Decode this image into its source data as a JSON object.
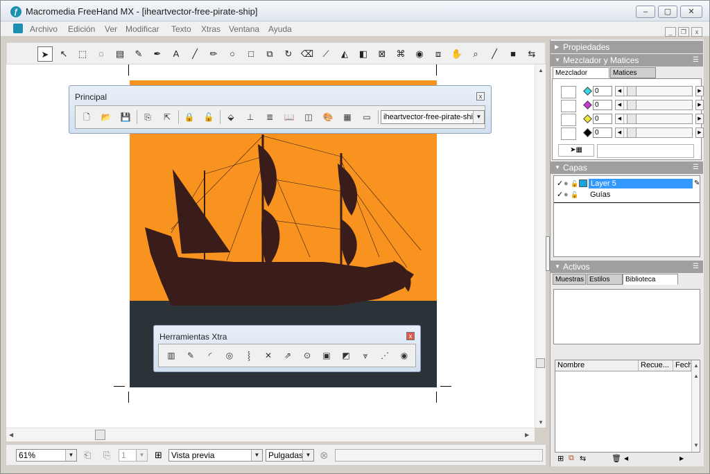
{
  "window": {
    "title": "Macromedia FreeHand MX - [iheartvector-free-pirate-ship]",
    "controls": {
      "minimize": "–",
      "maximize": "▢",
      "close": "✕"
    }
  },
  "menubar": {
    "items": [
      "Archivo",
      "Edición",
      "Ver",
      "Modificar",
      "Texto",
      "Xtras",
      "Ventana",
      "Ayuda"
    ],
    "mdi_controls": {
      "minimize": "_",
      "restore": "❐",
      "close": "x"
    }
  },
  "tools": [
    {
      "icon": "pointer-icon",
      "glyph": "➤"
    },
    {
      "icon": "subselect-icon",
      "glyph": "↖"
    },
    {
      "icon": "page-tool-icon",
      "glyph": "⬚"
    },
    {
      "icon": "lasso-icon",
      "glyph": "◌"
    },
    {
      "icon": "import-icon",
      "glyph": "▤"
    },
    {
      "icon": "eyedropper-icon",
      "glyph": "✎"
    },
    {
      "icon": "pen-icon",
      "glyph": "✒"
    },
    {
      "icon": "text-icon",
      "glyph": "A"
    },
    {
      "icon": "line-icon",
      "glyph": "╱"
    },
    {
      "icon": "pencil-icon",
      "glyph": "✏"
    },
    {
      "icon": "ellipse-icon",
      "glyph": "○"
    },
    {
      "icon": "rectangle-icon",
      "glyph": "□"
    },
    {
      "icon": "scale-icon",
      "glyph": "⧉"
    },
    {
      "icon": "rotate-icon",
      "glyph": "↻"
    },
    {
      "icon": "eraser-icon",
      "glyph": "⌫"
    },
    {
      "icon": "knife-icon",
      "glyph": "⟋"
    },
    {
      "icon": "reflect-icon",
      "glyph": "◭"
    },
    {
      "icon": "skew-icon",
      "glyph": "◧"
    },
    {
      "icon": "distort-icon",
      "glyph": "⊠"
    },
    {
      "icon": "brush-icon",
      "glyph": "⌘"
    },
    {
      "icon": "graphic-hose-icon",
      "glyph": "◉"
    },
    {
      "icon": "connector-icon",
      "glyph": "⧈"
    },
    {
      "icon": "hand-icon",
      "glyph": "✋"
    },
    {
      "icon": "zoom-icon",
      "glyph": "⌕"
    },
    {
      "icon": "stroke-color-icon",
      "glyph": "╱"
    },
    {
      "icon": "fill-color-icon",
      "glyph": "■"
    },
    {
      "icon": "swap-icon",
      "glyph": "⇆"
    }
  ],
  "principal_panel": {
    "title": "Principal",
    "close": "x",
    "icons": [
      "new-document-icon",
      "open-icon",
      "save-icon",
      "import-icon",
      "export-icon",
      "lock-icon",
      "unlock-icon",
      "group-icon",
      "align-icon",
      "text-wrap-icon",
      "library-icon",
      "layers-icon",
      "color-icon",
      "grid-icon",
      "swatches-icon"
    ],
    "glyphs": [
      "🗋",
      "📂",
      "💾",
      "⎘",
      "⇱",
      "🔒",
      "🔓",
      "⬙",
      "⊥",
      "≣",
      "📖",
      "◫",
      "🎨",
      "▦",
      "▭"
    ],
    "document_select": "iheartvector-free-pirate-ship"
  },
  "xtra_panel": {
    "title": "Herramientas Xtra",
    "close": "x",
    "icons": [
      "graph-icon",
      "eyedropper-icon",
      "arc-icon",
      "spiral-icon",
      "chart-3d-icon",
      "fisheye-icon",
      "smudge-icon",
      "3d-rotate-icon",
      "shadow-icon",
      "extrude-icon",
      "mirror-icon",
      "trace-icon",
      "roughen-icon"
    ],
    "glyphs": [
      "▥",
      "✎",
      "◜",
      "◎",
      "⸾",
      "✕",
      "⇗",
      "⊙",
      "▣",
      "◩",
      "⩔",
      "⋰",
      "◉"
    ]
  },
  "artwork": {
    "colors": {
      "sky": "#f7931e",
      "sea": "#2c3338",
      "ship": "#3a1d1a"
    }
  },
  "statusbar": {
    "zoom": "61%",
    "page_number": "1",
    "view_mode": "Vista previa",
    "units": "Pulgadas",
    "cancel_icon": "⊗"
  },
  "right_panels": {
    "propiedades": {
      "title": "Propiedades"
    },
    "mixer": {
      "title": "Mezclador y Matices",
      "tabs": [
        "Mezclador",
        "Matices"
      ],
      "active_tab": "Mezclador",
      "rows": [
        {
          "label": "cyan",
          "color": "#3cd6e0",
          "value": "0"
        },
        {
          "label": "magenta",
          "color": "#c23ad0",
          "value": "0"
        },
        {
          "label": "yellow",
          "color": "#f2e63a",
          "value": "0"
        },
        {
          "label": "black",
          "color": "#000000",
          "value": "0"
        }
      ]
    },
    "capas": {
      "title": "Capas",
      "layers": [
        {
          "name": "Layer 5",
          "selected": true,
          "color": "#1aa3d9"
        },
        {
          "name": "Guías",
          "selected": false
        }
      ]
    },
    "activos": {
      "title": "Activos",
      "tabs": [
        "Muestras",
        "Estilos",
        "Biblioteca"
      ],
      "active_tab": "Biblioteca",
      "columns": [
        "Nombre",
        "Recue...",
        "Fech"
      ]
    }
  }
}
